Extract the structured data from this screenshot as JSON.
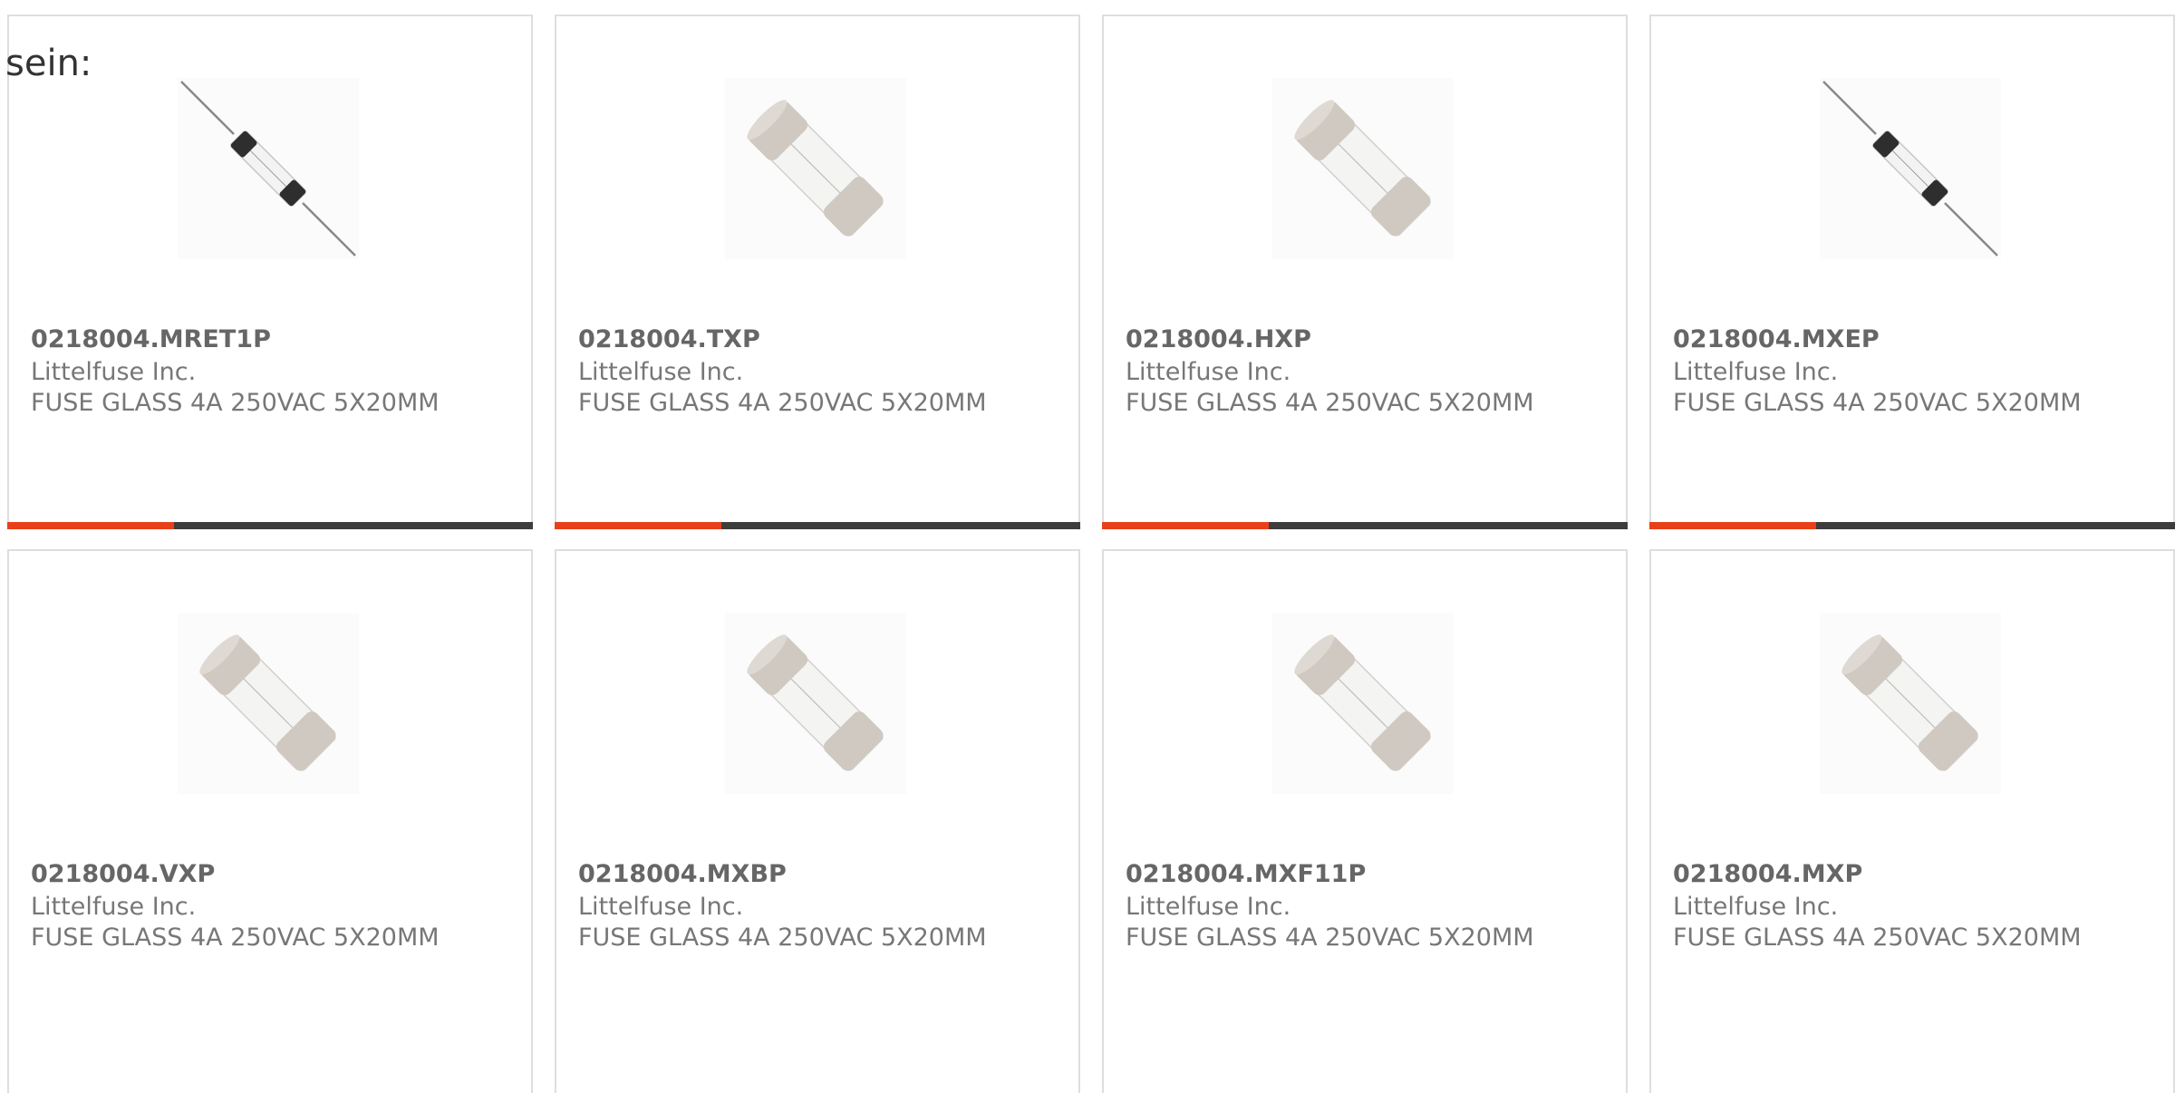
{
  "intro": {
    "text": "sein:"
  },
  "colors": {
    "accent": "#e8411a",
    "bar": "#3d3d3d",
    "border": "#dedede",
    "text_primary": "#666666",
    "text_secondary": "#777777"
  },
  "products": [
    {
      "part_number": "0218004.MRET1P",
      "manufacturer": "Littelfuse Inc.",
      "description": "FUSE GLASS 4A 250VAC 5X20MM",
      "image_icon": "axial-lead-glass-fuse-icon"
    },
    {
      "part_number": "0218004.TXP",
      "manufacturer": "Littelfuse Inc.",
      "description": "FUSE GLASS 4A 250VAC 5X20MM",
      "image_icon": "cartridge-glass-fuse-icon"
    },
    {
      "part_number": "0218004.HXP",
      "manufacturer": "Littelfuse Inc.",
      "description": "FUSE GLASS 4A 250VAC 5X20MM",
      "image_icon": "cartridge-glass-fuse-icon"
    },
    {
      "part_number": "0218004.MXEP",
      "manufacturer": "Littelfuse Inc.",
      "description": "FUSE GLASS 4A 250VAC 5X20MM",
      "image_icon": "axial-lead-glass-fuse-icon"
    },
    {
      "part_number": "0218004.VXP",
      "manufacturer": "Littelfuse Inc.",
      "description": "FUSE GLASS 4A 250VAC 5X20MM",
      "image_icon": "cartridge-glass-fuse-icon"
    },
    {
      "part_number": "0218004.MXBP",
      "manufacturer": "Littelfuse Inc.",
      "description": "FUSE GLASS 4A 250VAC 5X20MM",
      "image_icon": "cartridge-glass-fuse-icon"
    },
    {
      "part_number": "0218004.MXF11P",
      "manufacturer": "Littelfuse Inc.",
      "description": "FUSE GLASS 4A 250VAC 5X20MM",
      "image_icon": "cartridge-glass-fuse-icon"
    },
    {
      "part_number": "0218004.MXP",
      "manufacturer": "Littelfuse Inc.",
      "description": "FUSE GLASS 4A 250VAC 5X20MM",
      "image_icon": "cartridge-glass-fuse-icon"
    }
  ]
}
